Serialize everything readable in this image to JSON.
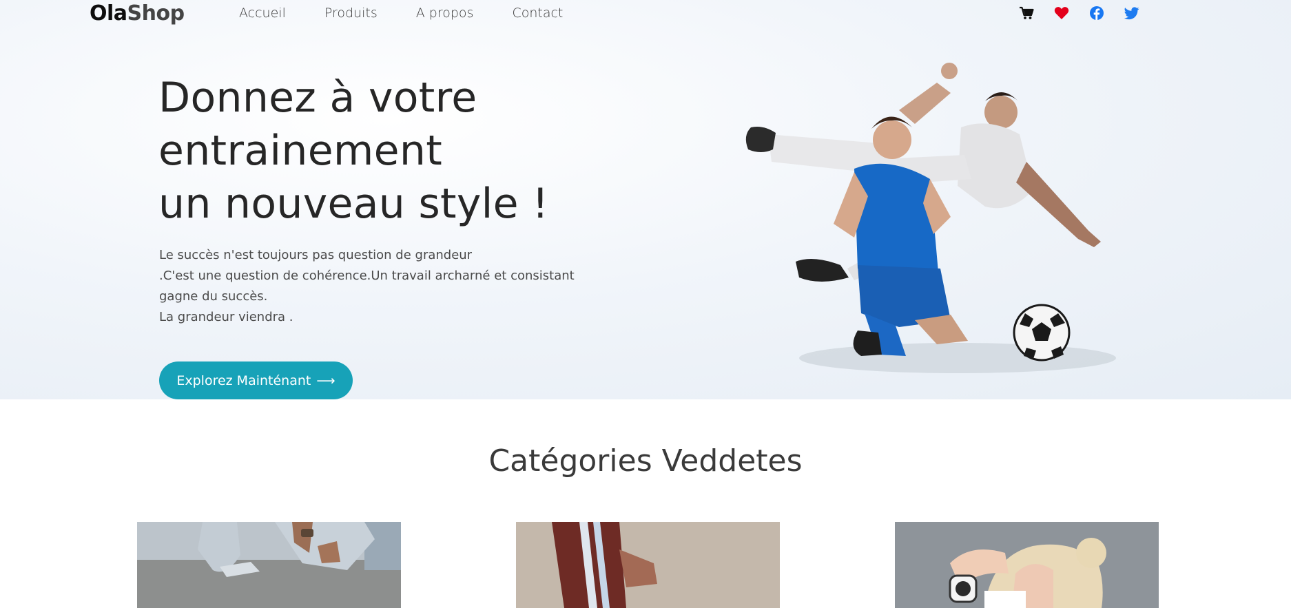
{
  "navbar": {
    "logo_primary": "Ola",
    "logo_secondary": "Shop",
    "links": [
      "Accueil",
      "Produits",
      "A propos",
      "Contact"
    ],
    "icons": [
      "cart-icon",
      "heart-icon",
      "facebook-icon",
      "twitter-icon"
    ]
  },
  "hero": {
    "title_lines": [
      "Donnez à votre",
      "entrainement",
      "un nouveau style !"
    ],
    "text_lines": [
      "Le succès n'est toujours pas question de grandeur",
      ".C'est une question de cohérence.Un travail archarné et consistant",
      "gagne du succès.",
      "La grandeur viendra ."
    ],
    "cta_label": "Explorez Mainténant",
    "cta_arrow": "⟶"
  },
  "categories": {
    "title": "Catégories Veddetes",
    "cards": [
      {
        "image": "jeans-person-image"
      },
      {
        "image": "track-pants-image"
      },
      {
        "image": "sport-watch-woman-image"
      }
    ]
  },
  "colors": {
    "accent": "#17a2b8",
    "heart": "#e3001b",
    "facebook": "#1877f2",
    "twitter": "#1da1f2",
    "cart": "#111111"
  }
}
